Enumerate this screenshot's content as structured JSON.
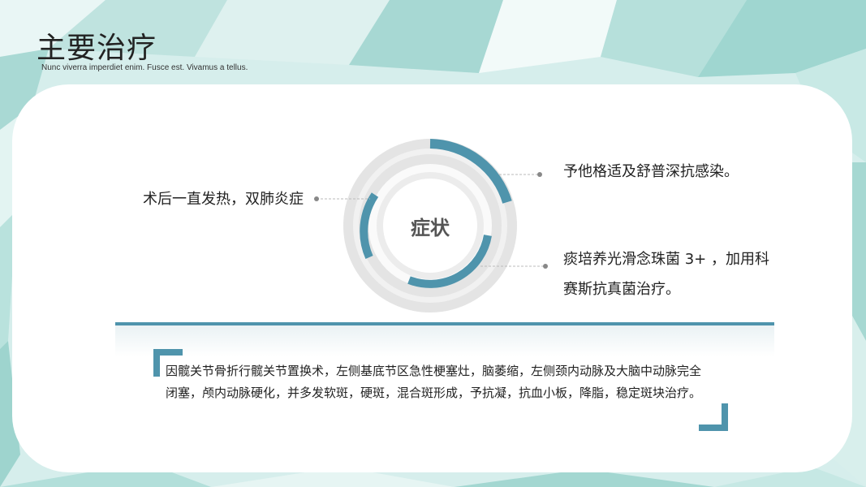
{
  "header": {
    "title": "主要治疗",
    "subtitle": "Nunc viverra imperdiet enim. Fusce est. Vivamus a tellus."
  },
  "diagram": {
    "center_label": "症状",
    "callouts": {
      "left": "术后一直发热，双肺炎症",
      "top_right": "予他格适及舒普深抗感染。",
      "bottom_right": "痰培养光滑念珠菌 3+ ，加用科赛斯抗真菌治疗。"
    }
  },
  "description": {
    "text": "因髋关节骨折行髋关节置换术，左侧基底节区急性梗塞灶，脑萎缩，左侧颈内动脉及大脑中动脉完全闭塞，颅内动脉硬化，并多发软斑，硬斑，混合斑形成，予抗凝，抗血小板，降脂，稳定斑块治疗。"
  },
  "colors": {
    "accent": "#4f94ac",
    "ring_gray": "#e4e4e4",
    "background": "#d6eeec"
  }
}
